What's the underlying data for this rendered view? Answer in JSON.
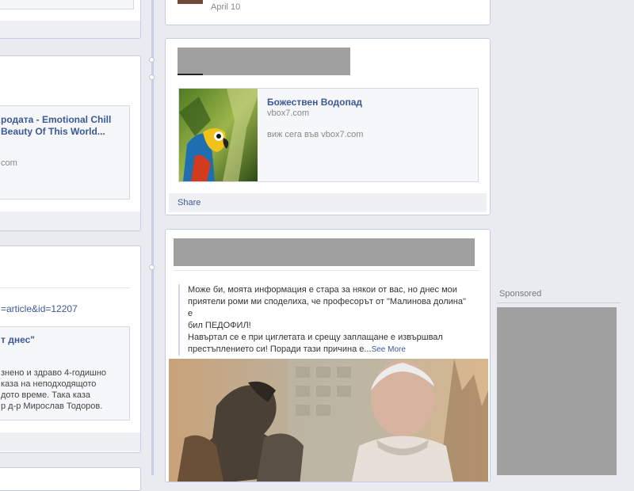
{
  "left_column": {
    "card2": {
      "link_title_line1": "родата - Emotional Chill",
      "link_title_line2": "Beauty Of This World...",
      "domain_fragment": "com"
    },
    "card3": {
      "url_fragment": "=article&id=12207",
      "title_fragment": "т днес\"",
      "desc_line1": "знено и здраво 4-годишно",
      "desc_line2": "каза на неподходящото",
      "desc_line3": "дото време. Така каза",
      "desc_line4": "р д-р Мирослав Тодоров."
    }
  },
  "right_column": {
    "post1": {
      "date": "April 10"
    },
    "post2": {
      "attachment_title": "Божествен Водопад",
      "attachment_domain": "vbox7.com",
      "attachment_desc": "виж сега във vbox7.com",
      "share_label": "Share"
    },
    "post3": {
      "quote_line1": "Може би, моята информация е стара за някои от вас, но днес мои",
      "quote_line2": "приятели роми ми споделиха, че професорът от \"Малинова долина\" е",
      "quote_line3": "бил ПЕДОФИЛ!",
      "quote_line4": "Навъртал се е при циглетата и срещу заплащане е извършвал",
      "quote_line5": "престъплението си! Поради тази причина е...",
      "see_more": "See More"
    }
  },
  "sidebar": {
    "sponsored_label": "Sponsored"
  },
  "colors": {
    "link": "#3b5998",
    "background": "#e9ebf0",
    "redaction": "#a0a0a0"
  }
}
